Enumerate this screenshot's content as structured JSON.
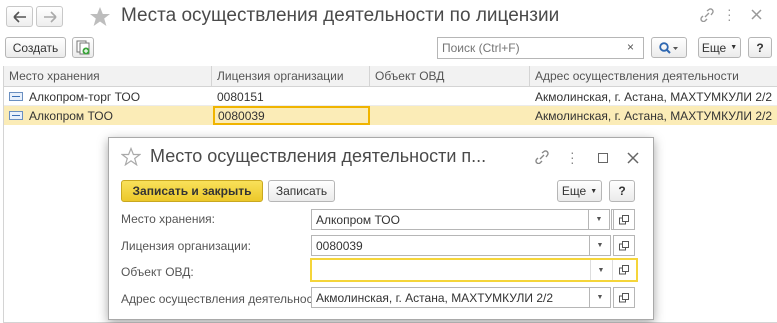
{
  "window": {
    "title": "Места осуществления деятельности по лицензии"
  },
  "toolbar": {
    "create_label": "Создать",
    "search_placeholder": "Поиск (Ctrl+F)",
    "more_label": "Еще",
    "help_label": "?"
  },
  "table": {
    "columns": [
      "Место хранения",
      "Лицензия организации",
      "Объект ОВД",
      "Адрес осуществления деятельности"
    ],
    "rows": [
      {
        "place": "Алкопром-торг ТОО",
        "license": "0080151",
        "object": "",
        "address": "Акмолинская, г. Астана, МАХТУМКУЛИ 2/2"
      },
      {
        "place": "Алкопром ТОО",
        "license": "0080039",
        "object": "",
        "address": "Акмолинская, г. Астана, МАХТУМКУЛИ 2/2"
      }
    ]
  },
  "dialog": {
    "title": "Место осуществления деятельности п...",
    "save_close_label": "Записать и закрыть",
    "save_label": "Записать",
    "more_label": "Еще",
    "help_label": "?",
    "fields": [
      {
        "label": "Место хранения:",
        "value": "Алкопром ТОО"
      },
      {
        "label": "Лицензия организации:",
        "value": "0080039"
      },
      {
        "label": "Объект ОВД:",
        "value": ""
      },
      {
        "label": "Адрес осуществления деятельности:",
        "value": "Акмолинская, г. Астана, МАХТУМКУЛИ 2/2"
      }
    ]
  },
  "colors": {
    "accent_yellow": "#f5d53a",
    "selection": "#fbecb7",
    "focus_border": "#f0b400"
  }
}
